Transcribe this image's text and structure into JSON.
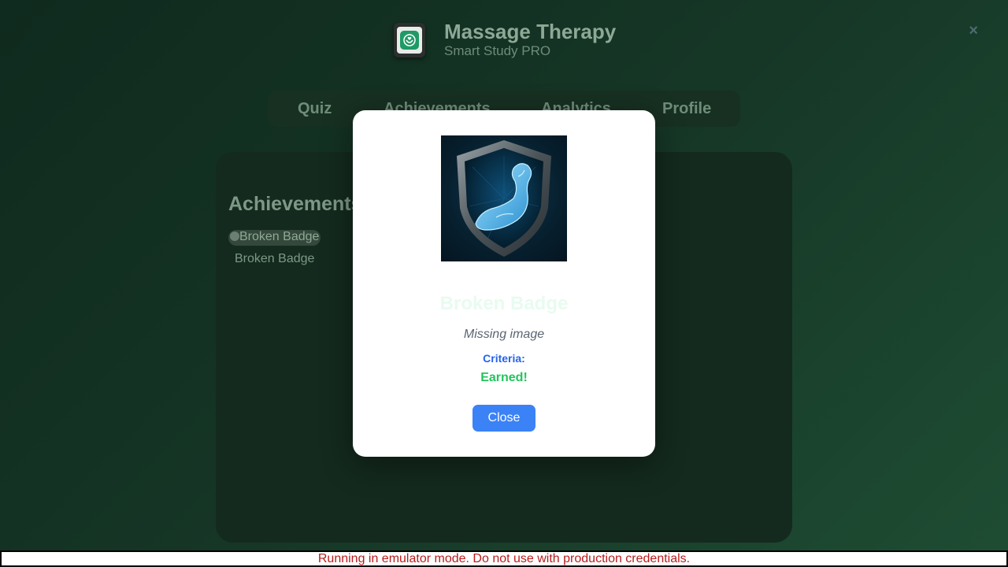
{
  "app": {
    "title": "Massage Therapy",
    "subtitle": "Smart Study PRO",
    "close_symbol": "×"
  },
  "nav": {
    "tabs": [
      {
        "label": "Quiz"
      },
      {
        "label": "Achievements"
      },
      {
        "label": "Analytics"
      },
      {
        "label": "Profile"
      }
    ]
  },
  "panel": {
    "title": "Achievements",
    "badge_alt": "Broken Badge",
    "badge_label": "Broken Badge"
  },
  "modal": {
    "title": "Broken Badge",
    "description": "Missing image",
    "criteria_label": "Criteria:",
    "status": "Earned!",
    "close_label": "Close",
    "image_icon": "flexed-arm-shield-icon"
  },
  "footer": {
    "emulator_warning": "Running in emulator mode. Do not use with production credentials."
  },
  "colors": {
    "accent_blue": "#3b82f6",
    "criteria_blue": "#2563eb",
    "earned_green": "#22c55e",
    "warning_red": "#b91c1c"
  }
}
